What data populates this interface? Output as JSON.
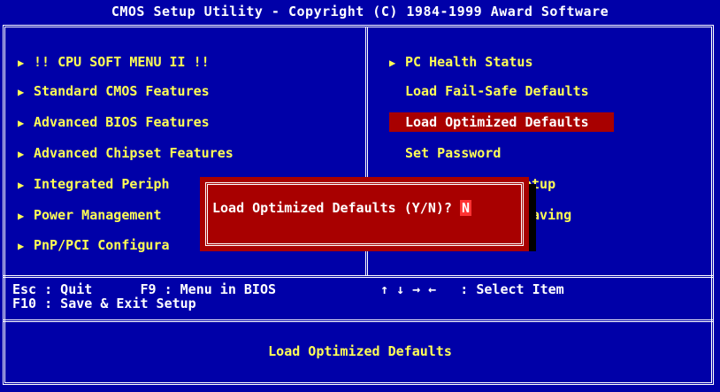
{
  "header": {
    "title": "CMOS Setup Utility - Copyright (C) 1984-1999 Award Software"
  },
  "menu": {
    "left": [
      {
        "label": "!! CPU SOFT MENU II !!",
        "has_submenu": true
      },
      {
        "label": "Standard CMOS Features",
        "has_submenu": true
      },
      {
        "label": "Advanced BIOS Features",
        "has_submenu": true
      },
      {
        "label": "Advanced Chipset Features",
        "has_submenu": true
      },
      {
        "label": "Integrated Periph",
        "has_submenu": true
      },
      {
        "label": "Power Management",
        "has_submenu": true
      },
      {
        "label": "PnP/PCI Configura",
        "has_submenu": true
      }
    ],
    "right": [
      {
        "label": "PC Health Status",
        "has_submenu": true
      },
      {
        "label": "Load Fail-Safe Defaults",
        "has_submenu": false
      },
      {
        "label": "Load Optimized Defaults",
        "has_submenu": false,
        "selected": true
      },
      {
        "label": "Set Password",
        "has_submenu": false
      },
      {
        "label": "etup",
        "has_submenu": false
      },
      {
        "label": "Saving",
        "has_submenu": false
      }
    ]
  },
  "dialog": {
    "prompt": "Load Optimized Defaults (Y/N)?",
    "answer": "N"
  },
  "help": {
    "line1_left": "Esc : Quit      F9 : Menu in BIOS",
    "line1_right": "↑ ↓ → ←   : Select Item",
    "line2_left": "F10 : Save & Exit Setup"
  },
  "status": {
    "text": "Load Optimized Defaults"
  },
  "colors": {
    "background": "#0000a8",
    "text": "#ffff55",
    "highlight": "#a80000",
    "border": "#ffffff"
  },
  "icons": {
    "submenu_arrow": "triangle-right-icon"
  }
}
